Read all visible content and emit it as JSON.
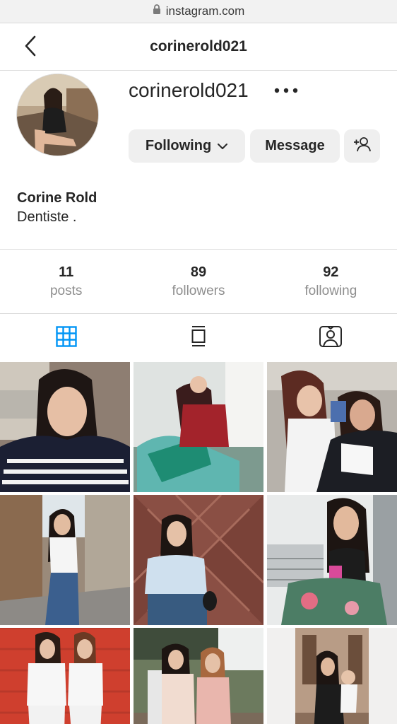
{
  "browser": {
    "url": "instagram.com",
    "lock_icon": "lock-icon"
  },
  "header": {
    "title": "corinerold021",
    "back_icon": "chevron-left-icon"
  },
  "profile": {
    "username": "corinerold021",
    "full_name": "Corine Rold",
    "bio": "Dentiste ."
  },
  "actions": {
    "following_label": "Following",
    "message_label": "Message"
  },
  "stats": [
    {
      "value": "11",
      "label": "posts"
    },
    {
      "value": "89",
      "label": "followers"
    },
    {
      "value": "92",
      "label": "following"
    }
  ],
  "tabs": [
    {
      "icon": "grid-icon",
      "active": true
    },
    {
      "icon": "feed-icon",
      "active": false
    },
    {
      "icon": "tagged-icon",
      "active": false
    }
  ],
  "colors": {
    "accent": "#0095f6",
    "text": "#262626",
    "muted": "#8e8e8e",
    "button_bg": "#efefef",
    "divider": "#dbdbdb"
  },
  "posts_count_visible": 9
}
